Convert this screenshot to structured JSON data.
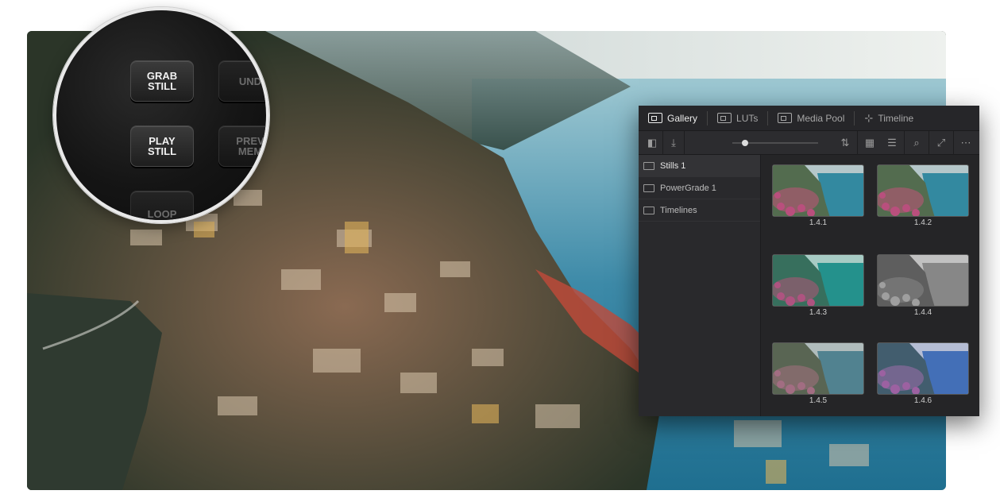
{
  "console": {
    "keys": [
      {
        "label": "GRAB\nSTILL"
      },
      {
        "label": "UND"
      },
      {
        "label": "PLAY\nSTILL"
      },
      {
        "label": "PREV\nMEM"
      },
      {
        "label": "LOOP"
      }
    ]
  },
  "gallery": {
    "tabs": [
      {
        "label": "Gallery",
        "icon": "gallery-icon"
      },
      {
        "label": "LUTs",
        "icon": "luts-icon"
      },
      {
        "label": "Media Pool",
        "icon": "media-pool-icon"
      },
      {
        "label": "Timeline",
        "icon": "timeline-icon"
      }
    ],
    "toolbar": {
      "slider_value": 0.15,
      "icons": [
        "sidebar-toggle-icon",
        "import-icon",
        "sort-icon",
        "grid-view-icon",
        "list-view-icon",
        "search-icon",
        "expand-icon",
        "more-icon"
      ]
    },
    "albums": [
      {
        "label": "Stills 1",
        "selected": true
      },
      {
        "label": "PowerGrade 1",
        "selected": false
      },
      {
        "label": "Timelines",
        "selected": false
      }
    ],
    "stills": [
      {
        "label": "1.4.1",
        "tone": "natural"
      },
      {
        "label": "1.4.2",
        "tone": "natural"
      },
      {
        "label": "1.4.3",
        "tone": "teal"
      },
      {
        "label": "1.4.4",
        "tone": "mono"
      },
      {
        "label": "1.4.5",
        "tone": "muted"
      },
      {
        "label": "1.4.6",
        "tone": "blue"
      }
    ]
  },
  "colors": {
    "sea": "#3d8aa8",
    "panel": "#2a2a2d",
    "accent": "#dcdcdc"
  }
}
